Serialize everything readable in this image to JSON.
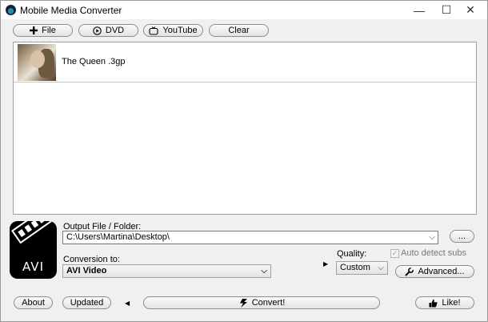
{
  "window": {
    "title": "Mobile Media Converter",
    "controls": {
      "minimize": "—",
      "maximize": "☐",
      "close": "✕"
    }
  },
  "toolbar": {
    "file_label": "File",
    "dvd_label": "DVD",
    "youtube_label": "YouTube",
    "clear_label": "Clear"
  },
  "files": [
    {
      "name": "The Queen .3gp"
    }
  ],
  "output": {
    "label": "Output File / Folder:",
    "path": "C:\\Users\\Martina\\Desktop\\",
    "browse_label": "..."
  },
  "conversion": {
    "label": "Conversion to:",
    "value": "AVI Video",
    "format_logo": "AVI"
  },
  "quality": {
    "label": "Quality:",
    "value": "Custom"
  },
  "auto_detect_subs": {
    "label": "Auto detect subs",
    "checked": true
  },
  "advanced_label": "Advanced...",
  "footer": {
    "about_label": "About",
    "updated_label": "Updated",
    "convert_label": "Convert!",
    "like_label": "Like!"
  }
}
